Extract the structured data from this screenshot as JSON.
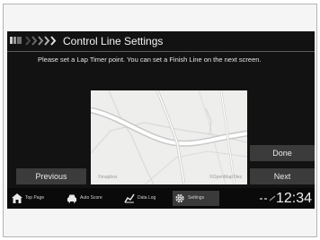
{
  "header": {
    "back_icon": "back-icon",
    "chevrons": "sweep-chevrons-icon",
    "title": "Control Line Settings"
  },
  "instruction": "Please set a Lap Timer point. You can set a Finish Line on the next screen.",
  "map": {
    "credit_left": "©mapbox",
    "credit_right": "©OpenMapTiles"
  },
  "buttons": {
    "previous": "Previous",
    "done": "Done",
    "next": "Next"
  },
  "nav": {
    "items": [
      {
        "label": "Top Page",
        "icon": "home-icon"
      },
      {
        "label": "Auto Score",
        "icon": "car-icon"
      },
      {
        "label": "Data Log",
        "icon": "chart-icon"
      },
      {
        "label": "Settings",
        "icon": "gear-icon"
      }
    ],
    "clock": "12:34"
  },
  "colors": {
    "screen_bg": "#121212",
    "button_bg": "#3b3b3b",
    "active_tab_bg": "#3a3a3a",
    "map_bg": "#eeeeec"
  }
}
